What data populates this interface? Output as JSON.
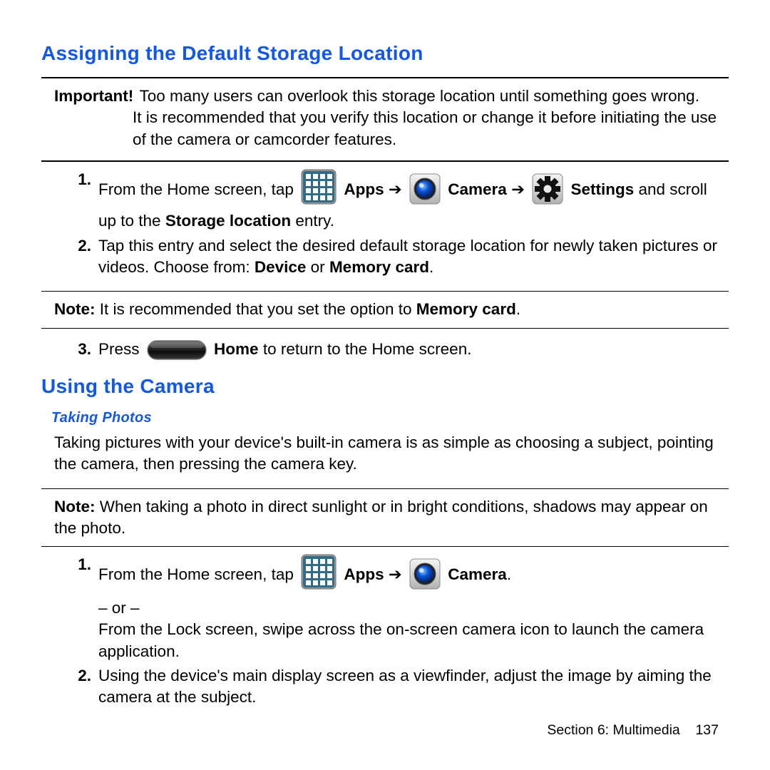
{
  "heading1": "Assigning the Default Storage Location",
  "important": {
    "label": "Important!",
    "text1": "Too many users can overlook this storage location until something goes wrong.",
    "text2": "It is recommended that you verify this location or change it before initiating the use of the camera or camcorder features."
  },
  "step1": {
    "num": "1.",
    "lead": "From the Home screen, tap ",
    "appsLabel": "Apps",
    "arrow1": " ➔ ",
    "cameraLabel": "Camera",
    "arrow2": " ➔ ",
    "settingsLabel": "Settings",
    "tail1": " and scroll up to the ",
    "storageLocBold": "Storage location",
    "tail2": " entry."
  },
  "step2": {
    "num": "2.",
    "text1": "Tap this entry and select the desired default storage location for newly taken pictures or videos. Choose from: ",
    "deviceBold": "Device",
    "or": " or ",
    "memcardBold": "Memory card",
    "dot": "."
  },
  "noteA": {
    "label": "Note:",
    "text": " It is recommended that you set the option to ",
    "memcardBold": "Memory card",
    "dot": "."
  },
  "step3": {
    "num": "3.",
    "lead": "Press ",
    "homeBold": "Home",
    "tail": " to return to the Home screen."
  },
  "heading2": "Using the Camera",
  "subheading": "Taking Photos",
  "intro": "Taking pictures with your device's built-in camera is as simple as choosing a subject, pointing the camera, then pressing the camera key.",
  "noteB": {
    "label": "Note:",
    "text": " When taking a photo in direct sunlight or in bright conditions, shadows may appear on the photo."
  },
  "stepB1": {
    "num": "1.",
    "lead": "From the Home screen, tap ",
    "appsLabel": "Apps",
    "arrow1": " ➔ ",
    "cameraLabel": "Camera",
    "dot": ".",
    "orDash": "– or –",
    "altText": "From the Lock screen, swipe across the on-screen camera icon to launch the camera application."
  },
  "stepB2": {
    "num": "2.",
    "text": "Using the device's main display screen as a viewfinder, adjust the image by aiming the camera at the subject."
  },
  "footer": {
    "section": "Section 6:  Multimedia",
    "page": "137"
  }
}
